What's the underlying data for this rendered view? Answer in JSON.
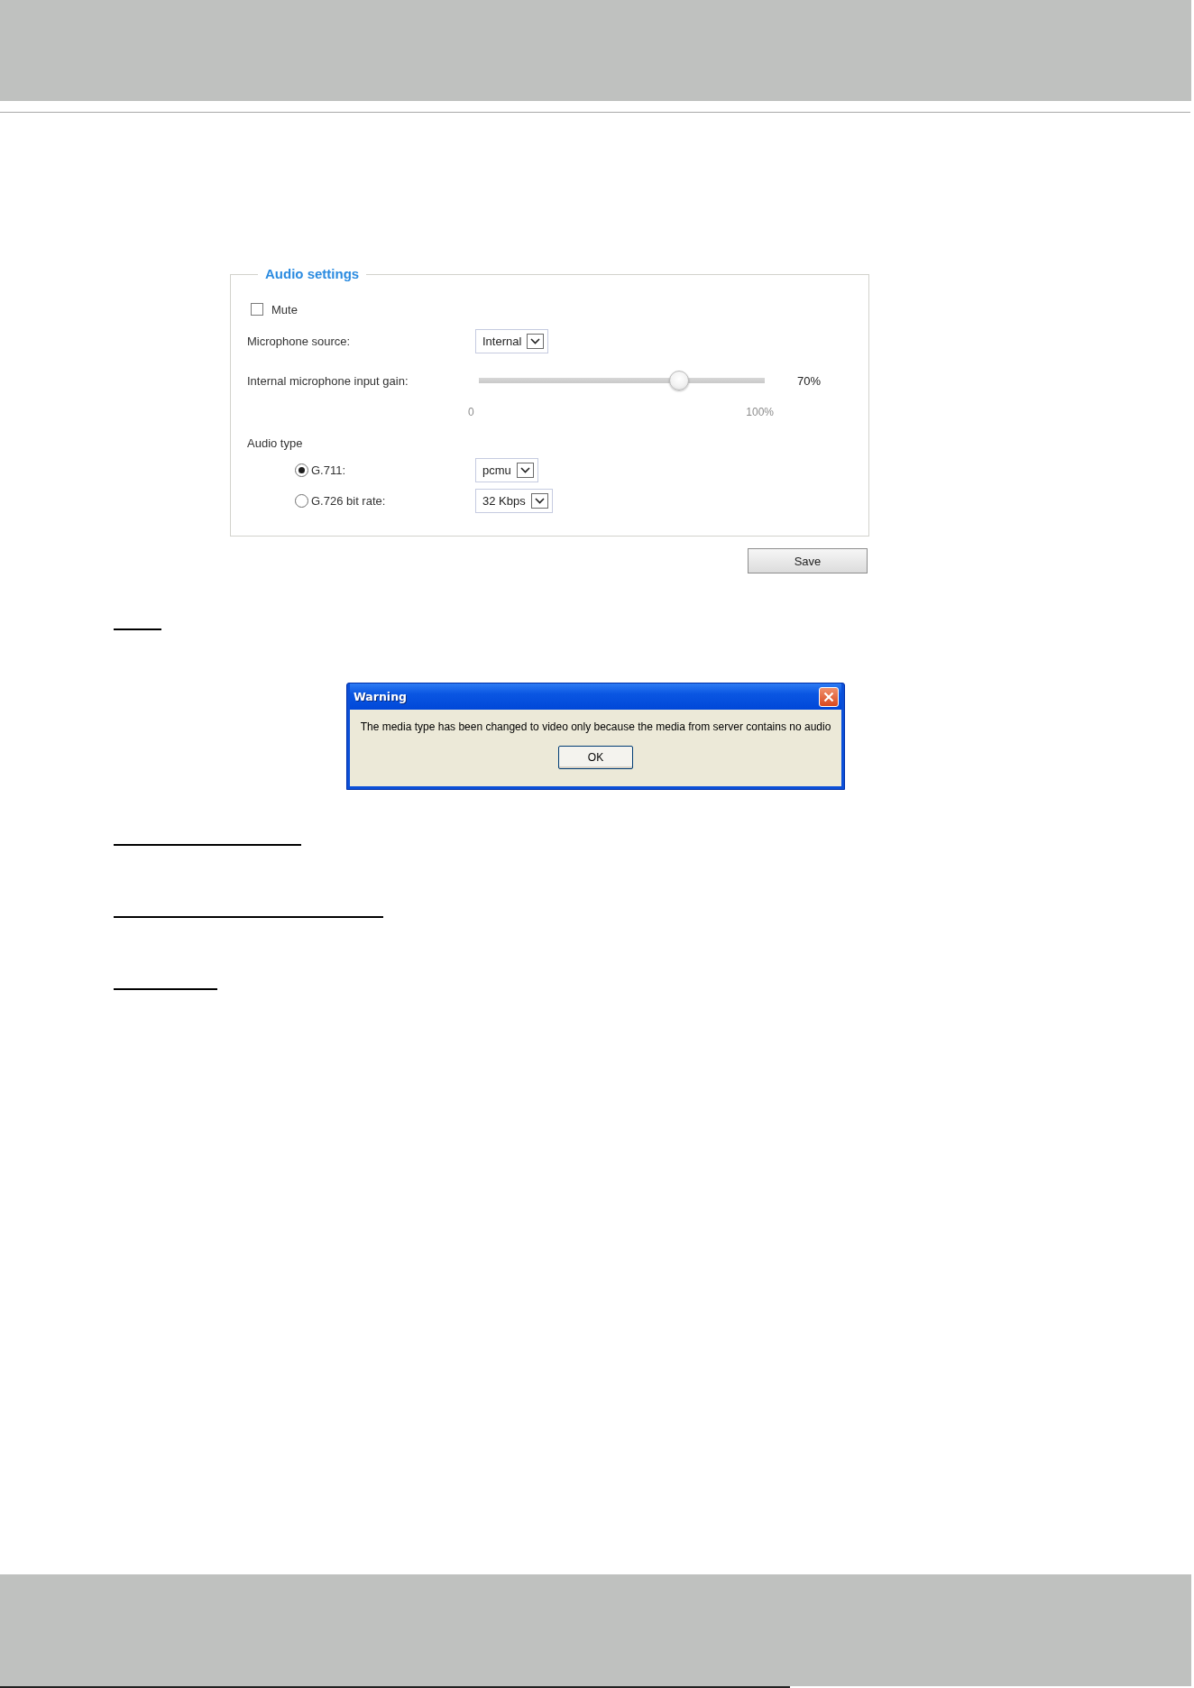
{
  "form": {
    "legend": "Audio settings",
    "mute": {
      "label": "Mute",
      "checked": false
    },
    "microphone_source": {
      "label": "Microphone source:",
      "value": "Internal"
    },
    "input_gain": {
      "label": "Internal microphone input gain:",
      "level": 0.7,
      "reading": "70%",
      "min_label": "0",
      "max_label": "100%"
    },
    "audio_type": {
      "label": "Audio type",
      "options": [
        {
          "label": "G.711:",
          "selected": true,
          "value": "pcmu"
        },
        {
          "label": "G.726 bit rate:",
          "selected": false,
          "value": "32 Kbps"
        }
      ]
    }
  },
  "save_button": "Save",
  "dialog": {
    "title": "Warning",
    "message": "The media type has been changed to video only because the media from server contains no audio",
    "button": "OK"
  }
}
